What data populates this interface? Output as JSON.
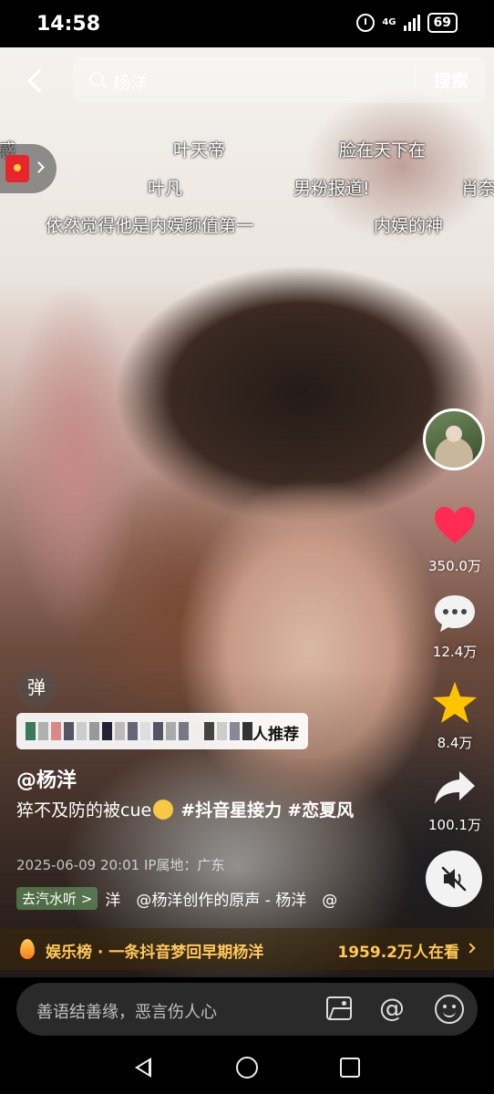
{
  "status_bar": {
    "time": "14:58",
    "network": "4G",
    "battery": "69"
  },
  "search": {
    "query": "杨洋",
    "button_label": "搜索"
  },
  "danmaku": [
    "感",
    "叶天帝",
    "脸在天下在",
    "叶凡",
    "男粉报道!",
    "肖奈",
    "依然觉得他是内娱颜值第一",
    "内娱的神"
  ],
  "actions": {
    "likes": "350.0万",
    "comments": "12.4万",
    "favorites": "8.4万",
    "shares": "100.1万"
  },
  "danmaku_toggle_label": "弹",
  "recommend_label": "人推荐",
  "post": {
    "author": "@杨洋",
    "caption_text": "猝不及防的被cue",
    "tags": [
      "#抖音星接力",
      "#恋夏风"
    ],
    "date": "2025-06-09 20:01",
    "ip_location": "IP属地：广东"
  },
  "music": {
    "chip_label": "去汽水听 >",
    "marquee": "洋　@杨洋创作的原声 - 杨洋　@"
  },
  "hot_banner": {
    "title": "娱乐榜 · 一条抖音梦回早期杨洋",
    "viewers": "1959.2万人在看"
  },
  "comment_bar": {
    "placeholder": "善语结善缘，恶言伤人心"
  },
  "colors": {
    "like_red": "#fe2c55",
    "favorite_yellow": "#ffc300",
    "banner_gold": "#ffc857"
  }
}
